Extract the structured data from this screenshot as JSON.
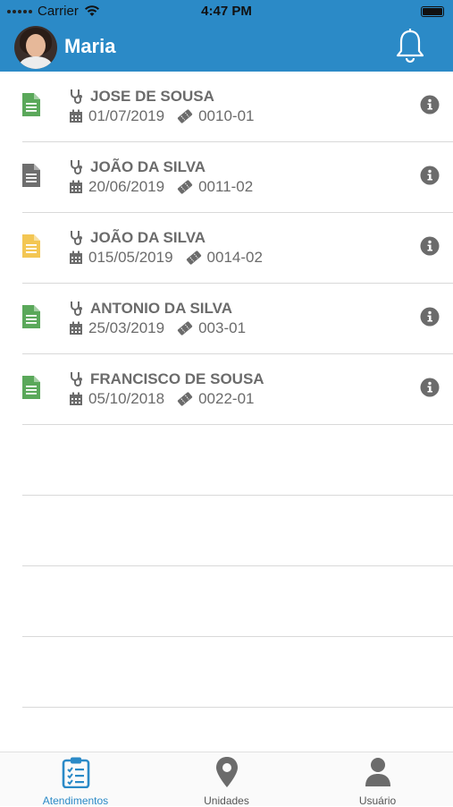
{
  "status_bar": {
    "carrier": "Carrier",
    "time": "4:47 PM"
  },
  "header": {
    "username": "Maria",
    "notification_icon": "bell-icon"
  },
  "colors": {
    "primary": "#2b8ac7",
    "doc_green": "#5aa85a",
    "doc_gray": "#6e6e6e",
    "doc_yellow": "#f3c653",
    "text": "#6b6b6b"
  },
  "appointments": [
    {
      "doctor": "JOSE DE SOUSA",
      "date": "01/07/2019",
      "code": "0010-01",
      "status_color": "green"
    },
    {
      "doctor": "JOÃO DA SILVA",
      "date": "20/06/2019",
      "code": "0011-02",
      "status_color": "gray"
    },
    {
      "doctor": "JOÃO DA SILVA",
      "date": "015/05/2019",
      "code": "0014-02",
      "status_color": "yellow"
    },
    {
      "doctor": "ANTONIO DA SILVA",
      "date": "25/03/2019",
      "code": "003-01",
      "status_color": "green"
    },
    {
      "doctor": "FRANCISCO DE SOUSA",
      "date": "05/10/2018",
      "code": "0022-01",
      "status_color": "green"
    }
  ],
  "tabs": [
    {
      "label": "Atendimentos",
      "icon": "clipboard-check-icon",
      "active": true
    },
    {
      "label": "Unidades",
      "icon": "map-pin-icon",
      "active": false
    },
    {
      "label": "Usuário",
      "icon": "user-icon",
      "active": false
    }
  ]
}
